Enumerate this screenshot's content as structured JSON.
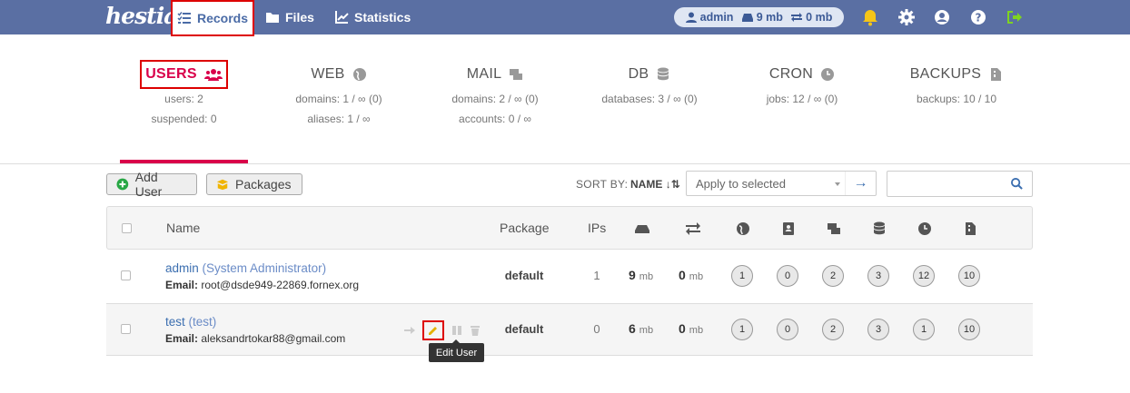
{
  "nav": {
    "logo": "hestia",
    "records": "Records",
    "files": "Files",
    "statistics": "Statistics",
    "user": "admin",
    "disk": "9 mb",
    "bandwidth": "0 mb"
  },
  "tabs": [
    {
      "title": "USERS",
      "stats": [
        "users: 2",
        "suspended: 0"
      ]
    },
    {
      "title": "WEB",
      "stats": [
        "domains: 1 / ∞ (0)",
        "aliases: 1 / ∞"
      ]
    },
    {
      "title": "MAIL",
      "stats": [
        "domains: 2 / ∞ (0)",
        "accounts: 0 / ∞"
      ]
    },
    {
      "title": "DB",
      "stats": [
        "databases: 3 / ∞ (0)"
      ]
    },
    {
      "title": "CRON",
      "stats": [
        "jobs: 12 / ∞ (0)"
      ]
    },
    {
      "title": "BACKUPS",
      "stats": [
        "backups: 10 / 10"
      ]
    }
  ],
  "toolbar": {
    "add_user": "Add User",
    "packages": "Packages",
    "sort_label": "SORT BY:",
    "sort_value": "NAME",
    "apply_placeholder": "Apply to selected"
  },
  "table": {
    "headers": {
      "name": "Name",
      "package": "Package",
      "ips": "IPs"
    },
    "rows": [
      {
        "user": "admin",
        "fullname": "(System Administrator)",
        "email_label": "Email:",
        "email": "root@dsde949-22869.fornex.org",
        "package": "default",
        "ips": "1",
        "disk": "9",
        "disk_unit": "mb",
        "bw": "0",
        "bw_unit": "mb",
        "web": "1",
        "dns": "0",
        "mail": "2",
        "db": "3",
        "cron": "12",
        "backups": "10"
      },
      {
        "user": "test",
        "fullname": "(test)",
        "email_label": "Email:",
        "email": "aleksandrtokar88@gmail.com",
        "package": "default",
        "ips": "0",
        "disk": "6",
        "disk_unit": "mb",
        "bw": "0",
        "bw_unit": "mb",
        "web": "1",
        "dns": "0",
        "mail": "2",
        "db": "3",
        "cron": "1",
        "backups": "10"
      }
    ]
  },
  "tooltip": "Edit User",
  "colors": {
    "nav_bg": "#5a6fa3",
    "accent": "#d9004a",
    "highlight": "#dd0000"
  }
}
